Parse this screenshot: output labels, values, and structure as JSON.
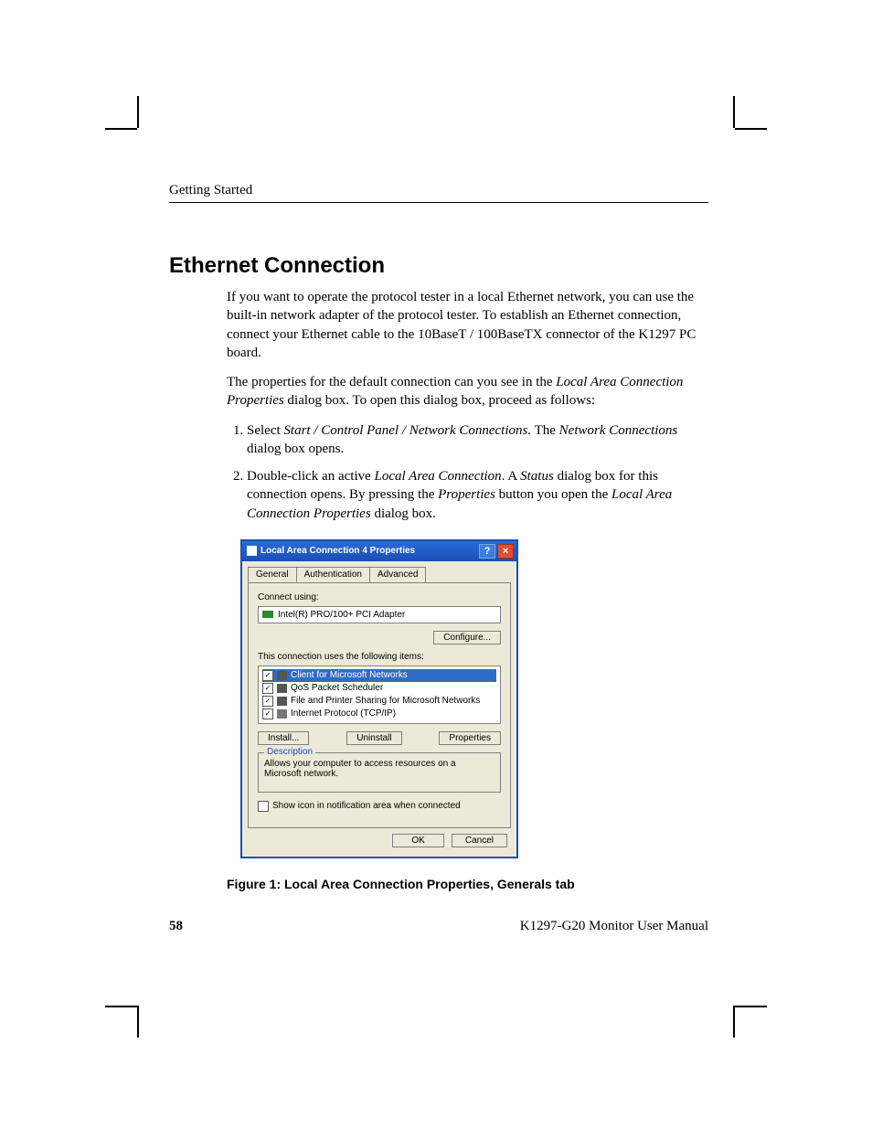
{
  "header": {
    "running_head": "Getting Started"
  },
  "section": {
    "title": "Ethernet Connection"
  },
  "para1": "If you want to operate the protocol tester in a local Ethernet network, you can use the built-in network adapter of the protocol tester. To establish an Ethernet connection, connect your Ethernet cable to the 10BaseT / 100BaseTX connector of the K1297 PC board.",
  "para2_a": "The properties for the default connection can you see in the ",
  "para2_i": "Local Area Connection Properties",
  "para2_b": " dialog box. To open this dialog box, proceed as follows:",
  "steps": {
    "s1_a": "Select ",
    "s1_i1": "Start / Control Panel / Network Connections.",
    "s1_b": " The ",
    "s1_i2": "Network Connections",
    "s1_c": " dialog box opens.",
    "s2_a": "Double-click an active ",
    "s2_i1": "Local Area Connection",
    "s2_b": ". A ",
    "s2_i2": "Status",
    "s2_c": " dialog box for this connection opens. By pressing the ",
    "s2_i3": "Properties",
    "s2_d": " button you open the ",
    "s2_i4": "Local Area Connection Properties",
    "s2_e": " dialog box."
  },
  "dialog": {
    "title": "Local Area Connection 4 Properties",
    "tabs": [
      "General",
      "Authentication",
      "Advanced"
    ],
    "connect_using_label": "Connect using:",
    "adapter": "Intel(R) PRO/100+ PCI Adapter",
    "configure_btn": "Configure...",
    "items_label": "This connection uses the following items:",
    "items": [
      "Client for Microsoft Networks",
      "QoS Packet Scheduler",
      "File and Printer Sharing for Microsoft Networks",
      "Internet Protocol (TCP/IP)"
    ],
    "install_btn": "Install...",
    "uninstall_btn": "Uninstall",
    "properties_btn": "Properties",
    "desc_title": "Description",
    "desc_text": "Allows your computer to access resources on a Microsoft network.",
    "show_icon": "Show icon in notification area when connected",
    "ok": "OK",
    "cancel": "Cancel"
  },
  "figure_caption": "Figure 1: Local Area Connection Properties, Generals tab",
  "footer": {
    "page": "58",
    "doc": "K1297-G20 Monitor User Manual"
  }
}
